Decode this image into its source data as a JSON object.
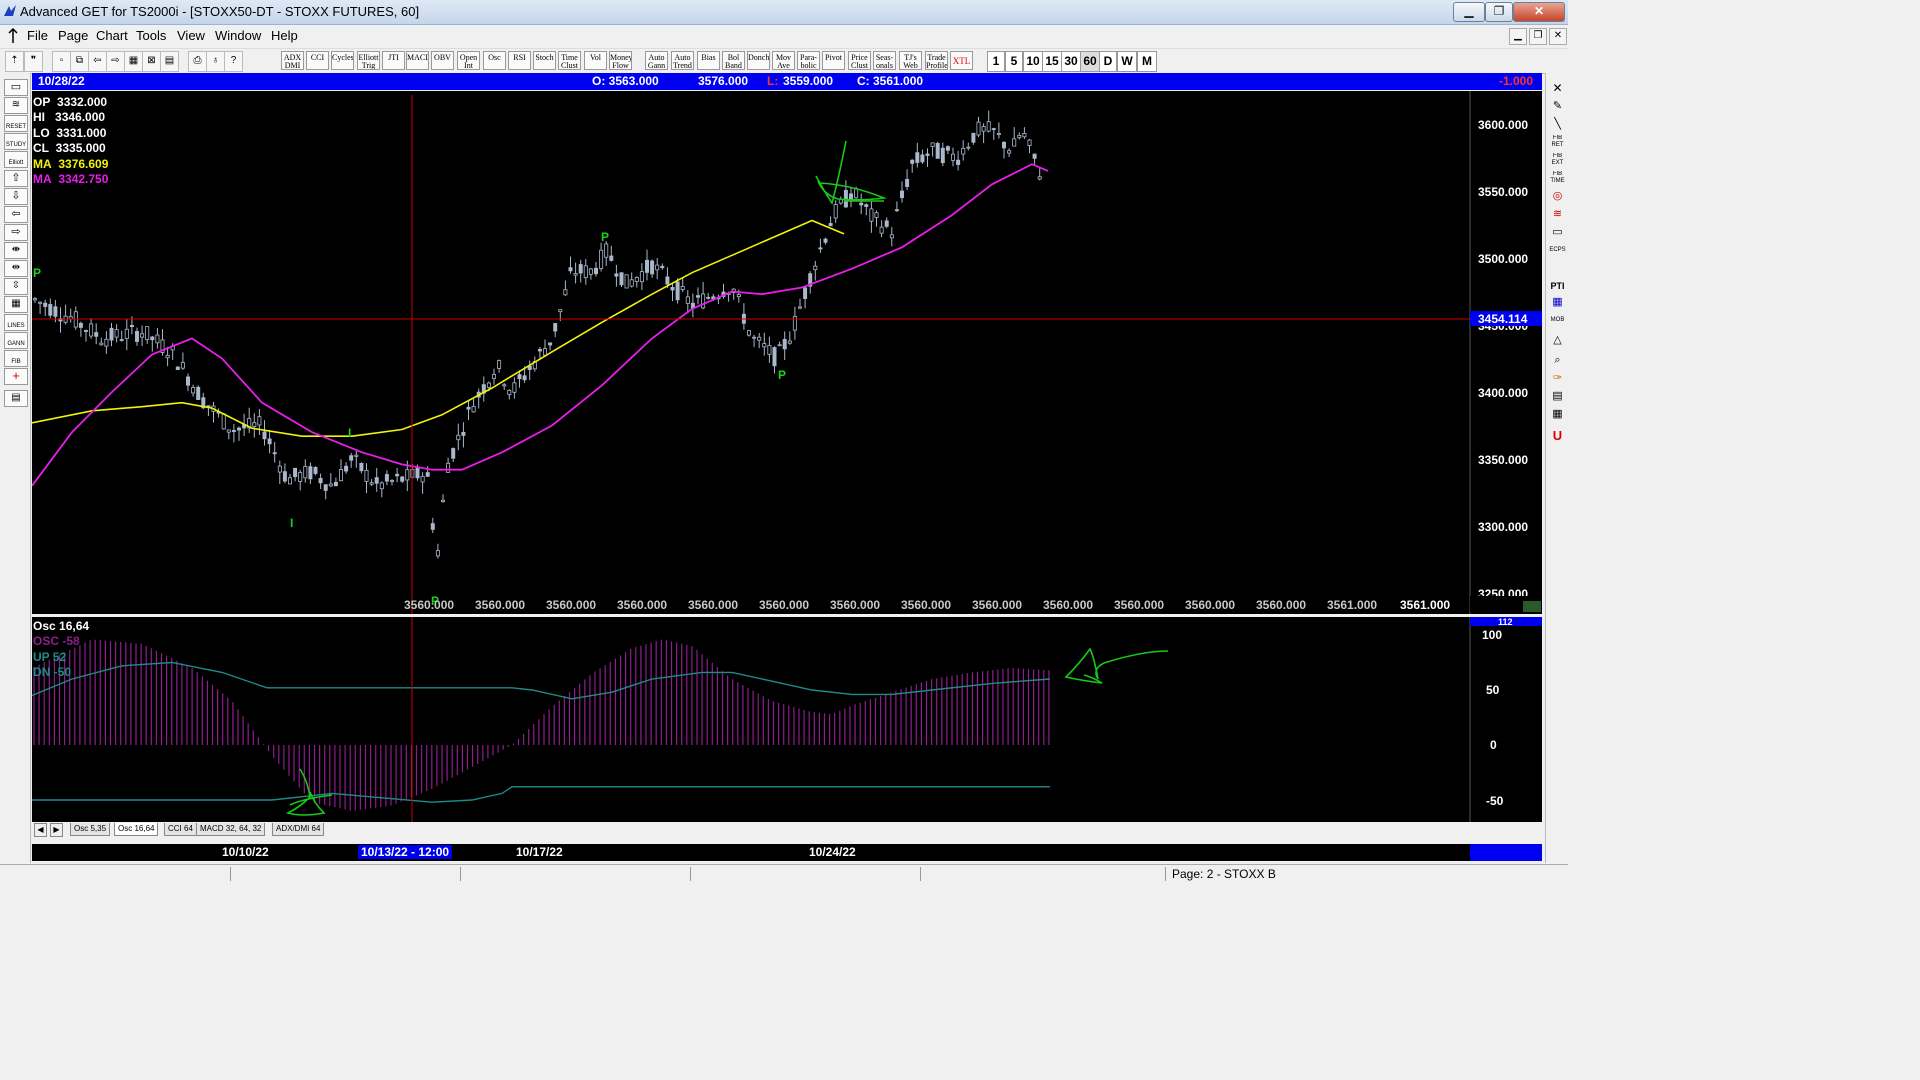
{
  "window": {
    "title": "Advanced GET for TS2000i - [STOXX50-DT - STOXX FUTURES, 60]"
  },
  "menu": [
    "File",
    "Page",
    "Chart",
    "Tools",
    "View",
    "Window",
    "Help"
  ],
  "toolbar": {
    "studies": [
      {
        "label": "ADX DMI",
        "name": "adx-dmi"
      },
      {
        "label": "CCI",
        "name": "cci"
      },
      {
        "label": "Cycles",
        "name": "cycles"
      },
      {
        "label": "Elliott Trig",
        "name": "elliott-trig"
      },
      {
        "label": "JTI",
        "name": "jti"
      },
      {
        "label": "MACD",
        "name": "macd"
      },
      {
        "label": "OBV",
        "name": "obv"
      },
      {
        "label": "Open Int",
        "name": "open-int"
      },
      {
        "label": "Osc",
        "name": "osc"
      },
      {
        "label": "RSI",
        "name": "rsi"
      },
      {
        "label": "Stoch",
        "name": "stoch"
      },
      {
        "label": "Time Clust",
        "name": "time-clust"
      },
      {
        "label": "Vol",
        "name": "vol"
      },
      {
        "label": "Money Flow",
        "name": "money-flow"
      },
      {
        "label": "Auto Gann",
        "name": "auto-gann"
      },
      {
        "label": "Auto Trend",
        "name": "auto-trend"
      },
      {
        "label": "Bias",
        "name": "bias"
      },
      {
        "label": "Bol Band",
        "name": "bol-band"
      },
      {
        "label": "Donch",
        "name": "donch"
      },
      {
        "label": "Mov Ave",
        "name": "mov-ave"
      },
      {
        "label": "Para-bolic",
        "name": "parabolic"
      },
      {
        "label": "Pivot",
        "name": "pivot"
      },
      {
        "label": "Price Clust",
        "name": "price-clust"
      },
      {
        "label": "Seas-onals",
        "name": "seasonals"
      },
      {
        "label": "TJ's Web",
        "name": "tjs-web"
      },
      {
        "label": "Trade Profile",
        "name": "trade-profile"
      },
      {
        "label": "XTL",
        "name": "xtl"
      }
    ],
    "timeframes": [
      "1",
      "5",
      "10",
      "15",
      "30",
      "60",
      "D",
      "W",
      "M"
    ]
  },
  "leftbar": [
    "RESET",
    "STUDY",
    "Elliott",
    "LINES",
    "GANN",
    "FIB"
  ],
  "rightbar": [
    "FIB RET",
    "FIB EXT",
    "FIB TIME",
    "ECPS",
    "PTI",
    "MOB"
  ],
  "header": {
    "date": "10/28/22",
    "open_label": "O: 3563.000",
    "high_value": "3576.000",
    "low_label": "L:",
    "low_value": "3559.000",
    "close_label": "C: 3561.000",
    "change": "-1.000"
  },
  "info": {
    "op": {
      "label": "OP",
      "value": "3332.000"
    },
    "hi": {
      "label": "HI",
      "value": "3346.000"
    },
    "lo": {
      "label": "LO",
      "value": "3331.000"
    },
    "cl": {
      "label": "CL",
      "value": "3335.000"
    },
    "ma1": {
      "label": "MA",
      "value": "3376.609"
    },
    "ma2": {
      "label": "MA",
      "value": "3342.750"
    }
  },
  "price_axis": [
    "3600.000",
    "3550.000",
    "3500.000",
    "3450.000",
    "3400.000",
    "3350.000",
    "3300.000",
    "3250.000"
  ],
  "crosshair_price": "3454.114",
  "bottom_labels": [
    "3560.000",
    "3560.000",
    "3560.000",
    "3560.000",
    "3560.000",
    "3560.000",
    "3560.000",
    "3560.000",
    "3560.000",
    "3560.000",
    "3560.000",
    "3560.000",
    "3560.000",
    "3561.000"
  ],
  "bottom_last": "3561.000",
  "pivots": [
    "P",
    "I",
    "P",
    "P",
    "P",
    "I"
  ],
  "osc": {
    "title": "Osc 16,64",
    "osc_label": "OSC -58",
    "up_label": "UP  52",
    "dn_label": "DN  -50",
    "axis": [
      "100",
      "50",
      "0",
      "-50"
    ],
    "top_marker": "112"
  },
  "tabs": [
    "Osc 5,35",
    "Osc 16,64",
    "CCI 64",
    "MACD 32, 64, 32",
    "ADX/DMI 64"
  ],
  "time_axis": [
    "10/10/22",
    "10/13/22 - 12:00",
    "10/17/22",
    "10/24/22"
  ],
  "status": {
    "page": "Page: 2 - STOXX B"
  },
  "colors": {
    "background": "#000000",
    "candles": "#aab8cc",
    "ma_fast": "#f2f20a",
    "ma_slow": "#e81ee8",
    "crosshair": "#c80000",
    "osc_hist": "#8b1f8b",
    "osc_bands": "#1f8a8a",
    "annotation": "#19c819",
    "bar_blue": "#0000f0"
  }
}
